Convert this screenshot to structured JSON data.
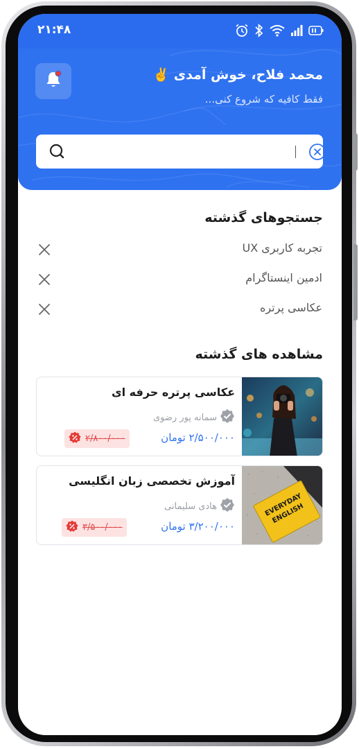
{
  "status_bar": {
    "time": "۲۱:۴۸",
    "icons": [
      "alarm-icon",
      "bluetooth-icon",
      "wifi-icon",
      "signal-icon",
      "battery-icon"
    ]
  },
  "header": {
    "welcome": "محمد فلاح، خوش آمدی ✌️",
    "subtitle": "فقط کافیه که شروع کنی...",
    "bell_icon": "bell-icon"
  },
  "search": {
    "value": "",
    "placeholder": "",
    "search_icon": "search-icon",
    "clear_icon": "clear-circle-icon"
  },
  "recent_searches": {
    "title": "جستجوهای گذشته",
    "items": [
      {
        "label": "تجربه کاربری UX"
      },
      {
        "label": "ادمین اینستاگرام"
      },
      {
        "label": "عکاسی پرتره"
      }
    ]
  },
  "recent_views": {
    "title": "مشاهده های گذشته",
    "items": [
      {
        "title": "عکاسی پرتره حرفه ای",
        "author": "سمانه پور رضوی",
        "price": "۲/۵۰۰/۰۰۰ تومان",
        "old_price": "۲/۸۰۰/۰۰۰"
      },
      {
        "title": "آموزش تخصصی زبان انگلیسی",
        "author": "هادی  سلیمانی",
        "price": "۳/۲۰۰/۰۰۰ تومان",
        "old_price": "۳/۵۰۰/۰۰۰",
        "book_text": "EVERYDAY ENGLISH"
      }
    ]
  },
  "colors": {
    "primary": "#2f72f0",
    "discount_bg": "#fde2e2",
    "discount_text": "#e24b4b"
  }
}
